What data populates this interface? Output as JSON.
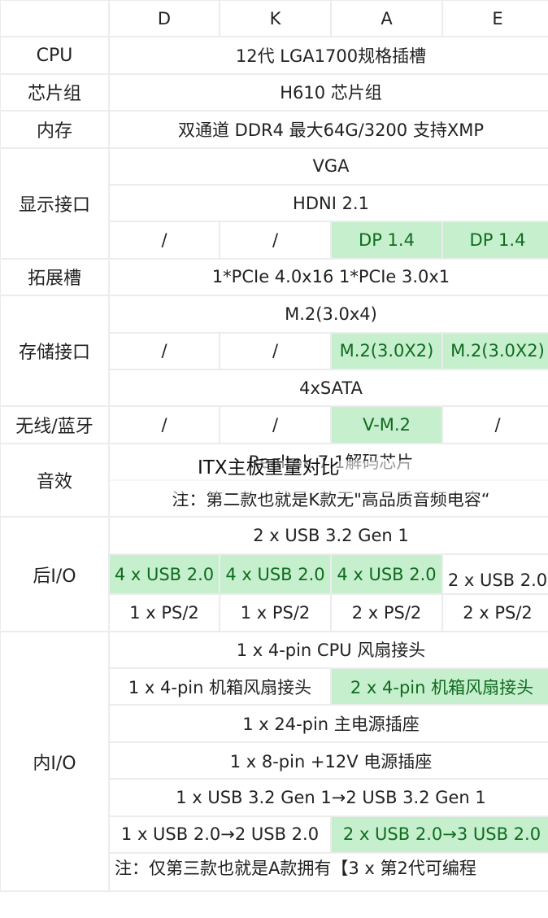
{
  "overlay_title": "ITX主板重量对比",
  "header": {
    "corner": "",
    "columns": [
      "D",
      "K",
      "A",
      "E"
    ]
  },
  "rows": {
    "cpu": {
      "label": "CPU",
      "value": "12代 LGA1700规格插槽"
    },
    "chipset": {
      "label": "芯片组",
      "value": "H610 芯片组"
    },
    "memory": {
      "label": "内存",
      "value": "双通道 DDR4 最大64G/3200 支持XMP"
    },
    "display": {
      "label": "显示接口",
      "vga": "VGA",
      "hdmi": "HDNI 2.1",
      "dp": [
        "/",
        "/",
        "DP 1.4",
        "DP 1.4"
      ]
    },
    "expansion": {
      "label": "拓展槽",
      "value": "1*PCIe 4.0x16 1*PCIe 3.0x1"
    },
    "storage": {
      "label": "存储接口",
      "m2_primary": "M.2(3.0x4)",
      "m2_secondary": [
        "/",
        "/",
        "M.2(3.0X2)",
        "M.2(3.0X2)"
      ],
      "sata": "4xSATA"
    },
    "wireless": {
      "label": "无线/蓝牙",
      "values": [
        "/",
        "/",
        "V-M.2",
        "/"
      ]
    },
    "audio": {
      "label": "音效",
      "codec": "Realtek 7.1解码芯片",
      "note": "注：第二款也就是K款无\"高品质音频电容“"
    },
    "rear_io": {
      "label": "后I/O",
      "usb32": "2 x USB 3.2 Gen 1",
      "usb20": [
        "4 x USB 2.0",
        "4 x USB 2.0",
        "4 x USB 2.0",
        "2 x USB 2.0"
      ],
      "ps2": [
        "1 x PS/2",
        "1 x PS/2",
        "2 x PS/2",
        "2 x PS/2"
      ]
    },
    "internal_io": {
      "label": "内I/O",
      "cpu_fan": "1 x 4-pin CPU 风扇接头",
      "case_fan": [
        "1 x 4-pin 机箱风扇接头",
        "2 x 4-pin 机箱风扇接头"
      ],
      "atx_power": "1 x 24-pin 主电源插座",
      "cpu_power": "1 x 8-pin +12V 电源插座",
      "usb32_header": "1 x USB 3.2 Gen 1→2 USB 3.2 Gen 1",
      "usb20_header": [
        "1 x USB 2.0→2 USB 2.0",
        "2 x USB 2.0→3 USB 2.0"
      ],
      "note": "注：仅第三款也就是A款拥有【3 x 第2代可编程"
    }
  },
  "colors": {
    "highlight_bg": "#c6efce",
    "highlight_text": "#0f6b1f",
    "border": "#ececec"
  }
}
